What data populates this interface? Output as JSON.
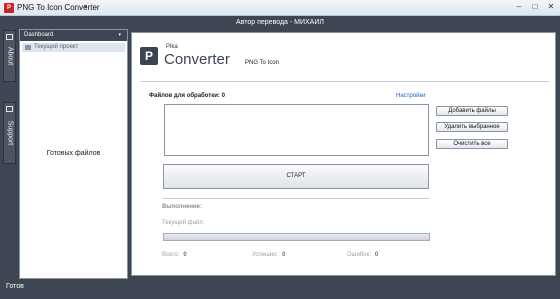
{
  "window": {
    "title": "PNG To Icon Converter",
    "menu_arrow": "▾",
    "minimize": "–",
    "maximize": "□",
    "close": "✕",
    "app_icon_letter": "P"
  },
  "translator_bar": "Автор перевода - МИХАИЛ",
  "left_tabs": {
    "about": "About",
    "support": "Support"
  },
  "side_panel": {
    "header": "Dashboard",
    "header_arrow": "▾",
    "current_project": "Текущий проект",
    "ready_files": "Готовых файлов"
  },
  "logo": {
    "letter": "P",
    "small": "Pika",
    "big": "Converter",
    "subtitle": "PNG To Icon"
  },
  "files": {
    "label": "Файлов для обработки: 0",
    "settings": "Настройки",
    "add_button": "Добавить файлы",
    "remove_button": "Удалить выбранное",
    "clear_button": "Очистить все",
    "start_button": "СТАРТ"
  },
  "progress": {
    "title": "Выполнение:",
    "current_file": "Текущий файл:",
    "value": 0,
    "total_label": "Всего:",
    "total_value": "0",
    "success_label": "Успешно:",
    "success_value": "0",
    "errors_label": "Ошибок:",
    "errors_value": "0"
  },
  "status": "Готов"
}
